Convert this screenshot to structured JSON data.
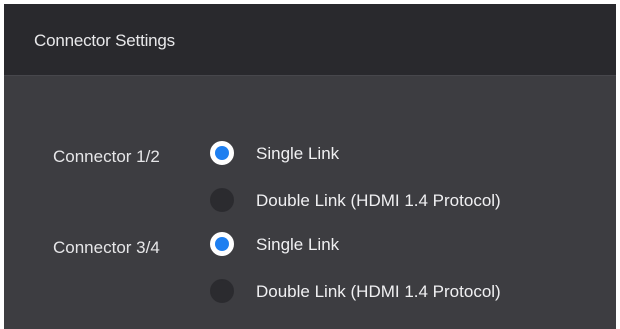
{
  "panel": {
    "title": "Connector Settings"
  },
  "connectors": [
    {
      "label": "Connector 1/2",
      "options": [
        {
          "label": "Single Link",
          "selected": true
        },
        {
          "label": "Double Link (HDMI 1.4 Protocol)",
          "selected": false
        }
      ]
    },
    {
      "label": "Connector 3/4",
      "options": [
        {
          "label": "Single Link",
          "selected": true
        },
        {
          "label": "Double Link (HDMI 1.4 Protocol)",
          "selected": false
        }
      ]
    }
  ],
  "colors": {
    "accent": "#1e7ff0",
    "panel_bg": "#3d3d41",
    "header_bg": "#29292d"
  }
}
